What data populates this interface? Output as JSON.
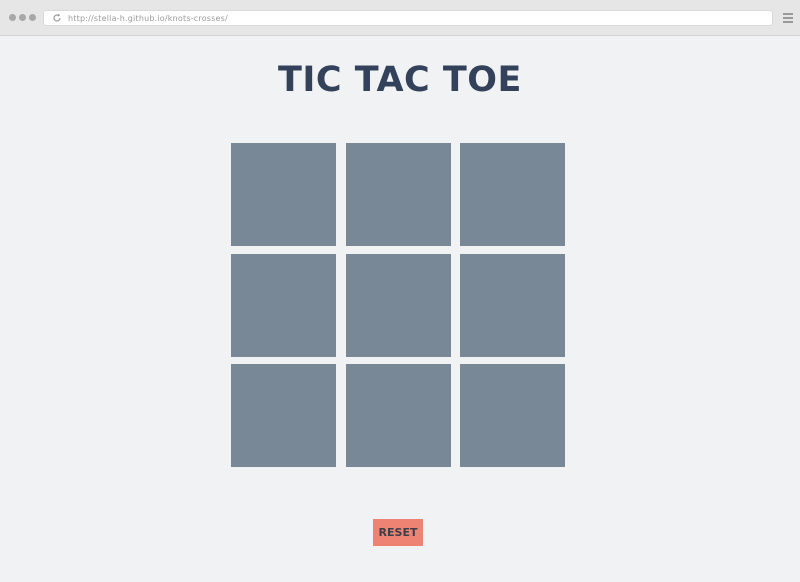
{
  "browser": {
    "url": "http://stella-h.github.io/knots-crosses/",
    "icons": {
      "reload": "reload-icon",
      "menu": "hamburger-menu-icon"
    }
  },
  "game": {
    "title": "TIC TAC TOE",
    "board": {
      "rows": 3,
      "columns": 3,
      "cells": [
        "",
        "",
        "",
        "",
        "",
        "",
        "",
        "",
        ""
      ]
    },
    "reset_label": "RESET"
  },
  "colors": {
    "background": "#f1f2f4",
    "title": "#33425a",
    "cell": "#788896",
    "reset_button": "#ee8273",
    "reset_text": "#3b3f4c"
  }
}
